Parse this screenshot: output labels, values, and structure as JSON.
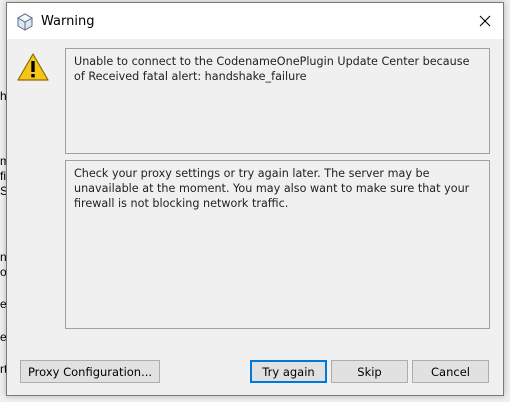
{
  "background": {
    "fragments": [
      "he",
      "m",
      "fi",
      "S",
      "ns",
      "oc",
      "e",
      "en",
      "rt"
    ]
  },
  "dialog": {
    "title": "Warning",
    "title_icon": "java-cup-icon",
    "close_icon": "close-icon",
    "warning_icon": "warning-triangle-icon",
    "message": "Unable to connect to the CodenameOnePlugin Update Center because of Received fatal alert: handshake_failure",
    "details": "Check your proxy settings or try again later. The server may be unavailable at the moment. You may also want to make sure that your firewall is not blocking network traffic.",
    "buttons": {
      "proxy": "Proxy Configuration...",
      "try_again": "Try again",
      "skip": "Skip",
      "cancel": "Cancel"
    }
  },
  "colors": {
    "accent": "#0078d7",
    "warning_fill": "#f5c518",
    "dialog_bg": "#f0f0f0"
  }
}
